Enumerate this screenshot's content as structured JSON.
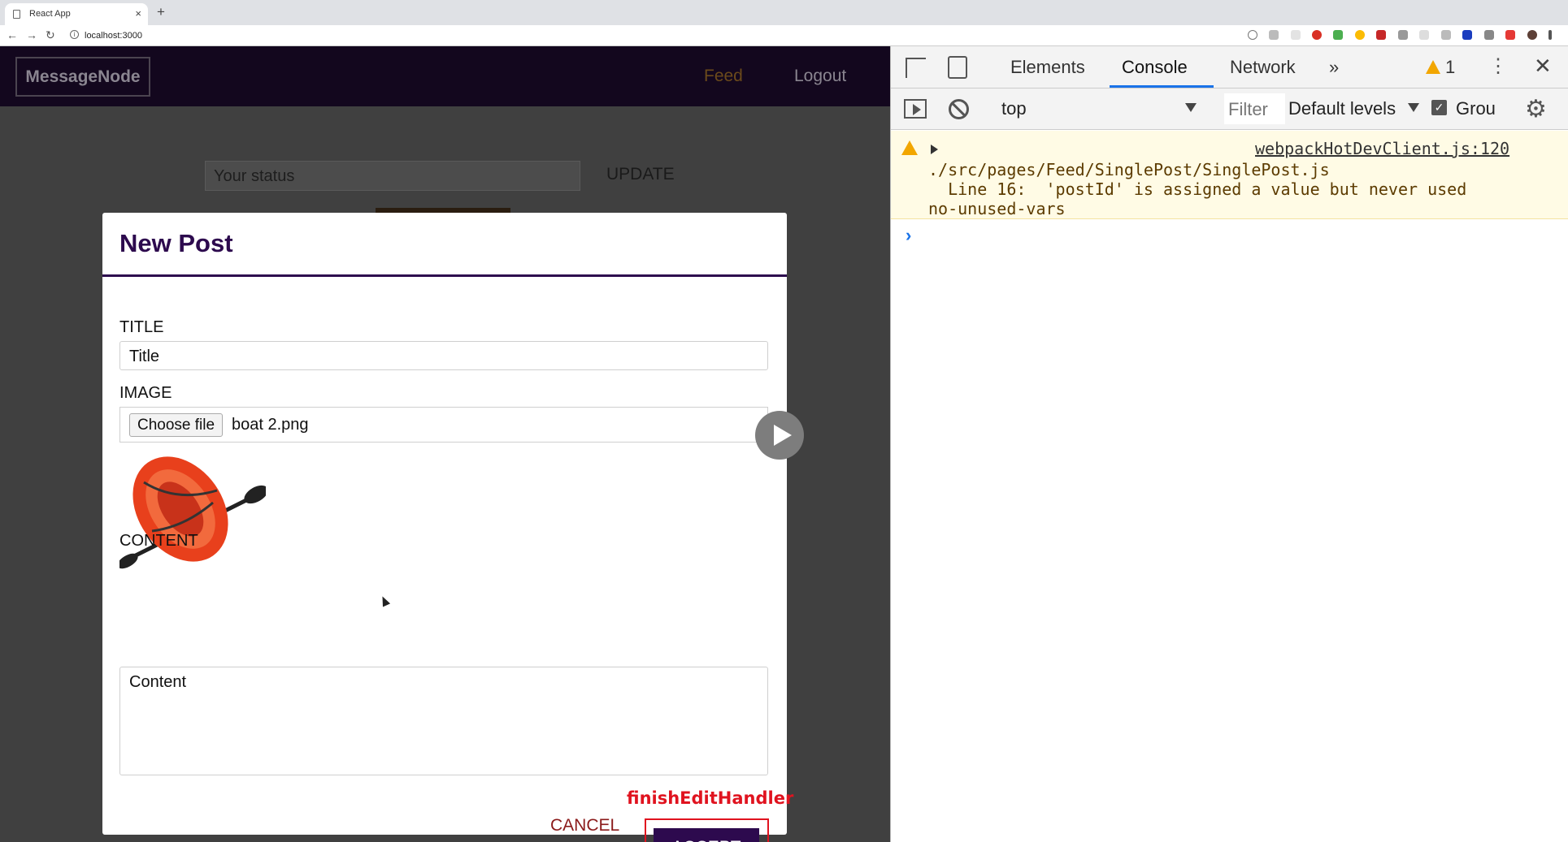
{
  "browser": {
    "tab_title": "React App",
    "tab_close": "×",
    "new_tab": "+",
    "url": "localhost:3000",
    "nav": {
      "back": "←",
      "forward": "→",
      "reload": "↻"
    }
  },
  "app": {
    "logo": "MessageNode",
    "nav_feed": "Feed",
    "nav_logout": "Logout",
    "status_placeholder": "Your status",
    "status_button": "UPDATE"
  },
  "modal": {
    "title": "New Post",
    "title_label": "TITLE",
    "title_placeholder": "Title",
    "image_label": "IMAGE",
    "choose_file": "Choose file",
    "file_name": "boat 2.png",
    "content_label": "CONTENT",
    "content_placeholder": "Content",
    "annotation": "finishEditHandler",
    "cancel": "CANCEL",
    "accept": "ACCEPT"
  },
  "devtools": {
    "tabs": [
      "Elements",
      "Console",
      "Network"
    ],
    "more": "»",
    "warning_count": "1",
    "context": "top",
    "filter_placeholder": "Filter",
    "levels": "Default levels",
    "group": "Grou",
    "console": {
      "source": "webpackHotDevClient.js:120",
      "lines": [
        "./src/pages/Feed/SinglePost/SinglePost.js",
        "  Line 16:  'postId' is assigned a value but never used",
        "no-unused-vars"
      ],
      "prompt": "›"
    }
  },
  "colors": {
    "accent": "#2d0a4e",
    "header": "#13071e",
    "annotation": "#e0131f",
    "warning": "#f2a600"
  }
}
